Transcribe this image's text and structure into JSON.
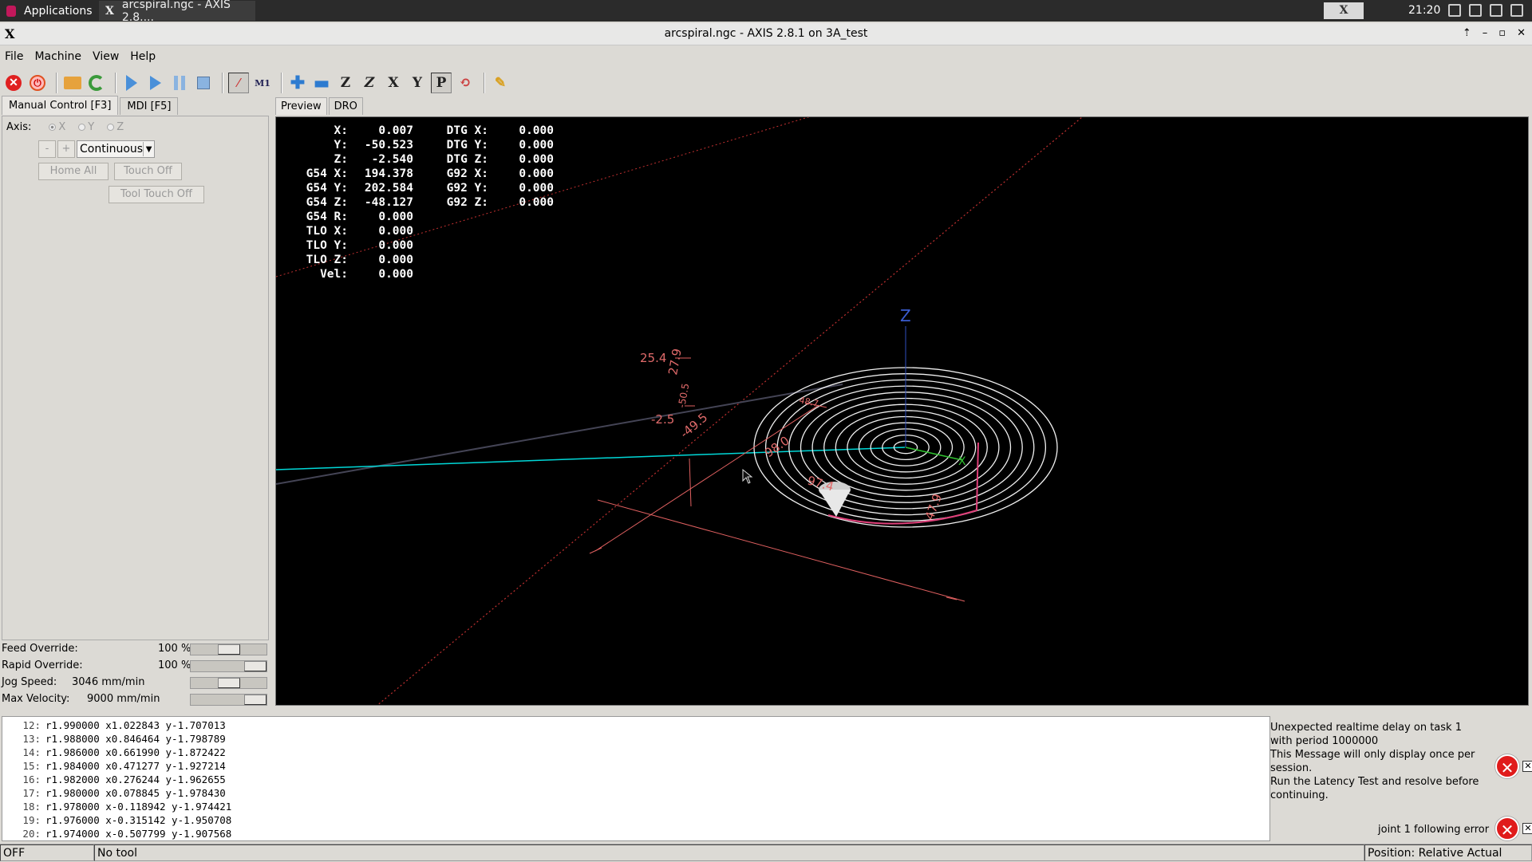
{
  "taskbar": {
    "applications_label": "Applications",
    "task_title": "arcspiral.ngc - AXIS 2.8....",
    "clock": "21:20"
  },
  "window": {
    "title": "arcspiral.ngc - AXIS 2.8.1 on 3A_test"
  },
  "menu": [
    "File",
    "Machine",
    "View",
    "Help"
  ],
  "toolbar": {
    "icons": [
      "estop-icon",
      "power-icon",
      "open-file-icon",
      "reload-icon",
      "run-icon",
      "step-icon",
      "pause-icon",
      "stop-icon",
      "touch-off-icon",
      "block-delete-icon",
      "zoom-in-icon",
      "zoom-out-icon",
      "view-z-icon",
      "view-z2-icon",
      "view-x-icon",
      "view-y-icon",
      "view-p-icon",
      "rotate-icon",
      "clear-plot-icon"
    ]
  },
  "left_tabs": [
    {
      "label": "Manual Control [F3]",
      "active": true
    },
    {
      "label": "MDI [F5]",
      "active": false
    }
  ],
  "manual": {
    "axis_label": "Axis:",
    "axes": [
      "X",
      "Y",
      "Z"
    ],
    "selected_axis": "X",
    "jog_minus": "-",
    "jog_plus": "+",
    "jog_mode": "Continuous",
    "home_all": "Home All",
    "touch_off": "Touch Off",
    "tool_touch_off": "Tool Touch Off"
  },
  "overrides": [
    {
      "label": "Feed Override:",
      "value": "100 %",
      "fraction": 0.5
    },
    {
      "label": "Rapid Override:",
      "value": "100 %",
      "fraction": 1.0
    },
    {
      "label": "Jog Speed:",
      "value": "3046 mm/min",
      "fraction": 0.5
    },
    {
      "label": "Max Velocity:",
      "value": "9000 mm/min",
      "fraction": 1.0
    }
  ],
  "right_tabs": [
    {
      "label": "Preview",
      "active": true
    },
    {
      "label": "DRO",
      "active": false
    }
  ],
  "dro": [
    {
      "l1": "X:",
      "v1": "0.007",
      "l2": "DTG X:",
      "v2": "0.000"
    },
    {
      "l1": "Y:",
      "v1": "-50.523",
      "l2": "DTG Y:",
      "v2": "0.000"
    },
    {
      "l1": "Z:",
      "v1": "-2.540",
      "l2": "DTG Z:",
      "v2": "0.000"
    },
    {
      "l1": "G54 X:",
      "v1": "194.378",
      "l2": "G92 X:",
      "v2": "0.000"
    },
    {
      "l1": "G54 Y:",
      "v1": "202.584",
      "l2": "G92 Y:",
      "v2": "0.000"
    },
    {
      "l1": "G54 Z:",
      "v1": "-48.127",
      "l2": "G92 Z:",
      "v2": "0.000"
    },
    {
      "l1": "G54 R:",
      "v1": "0.000",
      "l2": "",
      "v2": ""
    },
    {
      "l1": "TLO X:",
      "v1": "0.000",
      "l2": "",
      "v2": ""
    },
    {
      "l1": "TLO Y:",
      "v1": "0.000",
      "l2": "",
      "v2": ""
    },
    {
      "l1": "TLO Z:",
      "v1": "0.000",
      "l2": "",
      "v2": ""
    },
    {
      "l1": "Vel:",
      "v1": "0.000",
      "l2": "",
      "v2": ""
    }
  ],
  "preview_labels": {
    "z_axis": "Z",
    "x_axis": "X",
    "dim_top": "48.7",
    "dim_diag": "98.0",
    "dim_25": "25.4",
    "dim_vert": "27.9",
    "dim_50": "-50.5",
    "dim_neg25": "-2.5",
    "dim_neg495": "-49.5",
    "dim_974": "97.4",
    "dim_479": "47.9"
  },
  "gcode_lines": [
    {
      "num": "12:",
      "text": "r1.990000 x1.022843 y-1.707013"
    },
    {
      "num": "13:",
      "text": "r1.988000 x0.846464 y-1.798789"
    },
    {
      "num": "14:",
      "text": "r1.986000 x0.661990 y-1.872422"
    },
    {
      "num": "15:",
      "text": "r1.984000 x0.471277 y-1.927214"
    },
    {
      "num": "16:",
      "text": "r1.982000 x0.276244 y-1.962655"
    },
    {
      "num": "17:",
      "text": "r1.980000 x0.078845 y-1.978430"
    },
    {
      "num": "18:",
      "text": "r1.978000 x-0.118942 y-1.974421"
    },
    {
      "num": "19:",
      "text": "r1.976000 x-0.315142 y-1.950708"
    },
    {
      "num": "20:",
      "text": "r1.974000 x-0.507799 y-1.907568"
    }
  ],
  "messages": {
    "msg1": "Unexpected realtime delay on task 1 with period 1000000\nThis Message will only display once per session.\nRun the Latency Test and resolve before continuing.",
    "msg2": "joint 1 following error"
  },
  "status": {
    "state": "OFF",
    "tool": "No tool",
    "position": "Position: Relative Actual"
  },
  "colors": {
    "preview_bg": "#000000",
    "spiral": "#ffffff",
    "dimension": "#ff6666",
    "x_axis": "#00e0e0",
    "estop": "#e02020"
  }
}
